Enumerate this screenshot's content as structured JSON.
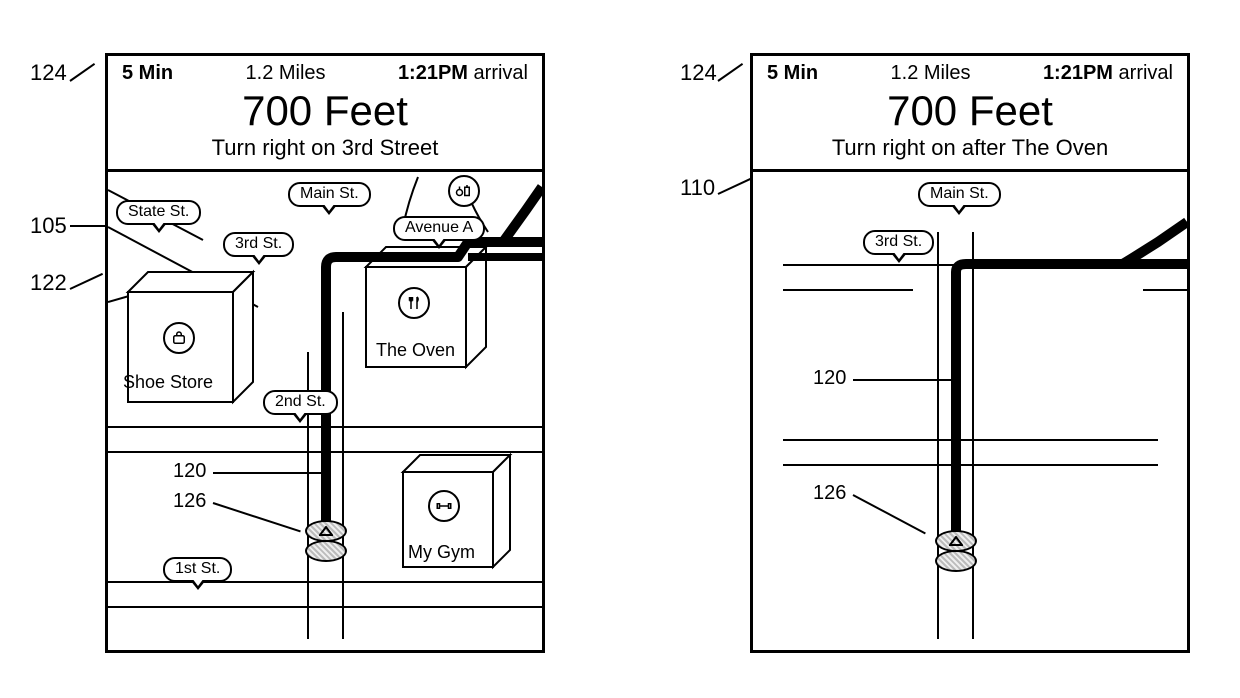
{
  "left": {
    "status": {
      "time": "5 Min",
      "dist": "1.2 Miles",
      "arrival_time": "1:21PM",
      "arrival_word": "arrival"
    },
    "distance": "700 Feet",
    "instruction": "Turn right on 3rd Street",
    "streets": {
      "state": "State St.",
      "main": "Main St.",
      "third": "3rd St.",
      "second": "2nd St.",
      "first": "1st St.",
      "avenueA": "Avenue A"
    },
    "poi": {
      "shoe": "Shoe Store",
      "oven": "The Oven",
      "gym": "My Gym"
    }
  },
  "right": {
    "status": {
      "time": "5 Min",
      "dist": "1.2 Miles",
      "arrival_time": "1:21PM",
      "arrival_word": "arrival"
    },
    "distance": "700 Feet",
    "instruction": "Turn right on after The Oven",
    "streets": {
      "main": "Main St.",
      "third": "3rd St."
    }
  },
  "refs": {
    "r124a": "124",
    "r105": "105",
    "r122": "122",
    "r124b": "124",
    "r110": "110",
    "r120a": "120",
    "r126a": "126",
    "r120b": "120",
    "r126b": "126"
  }
}
